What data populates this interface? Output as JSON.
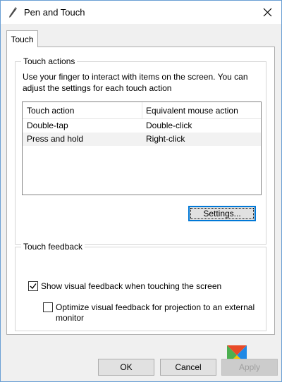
{
  "window": {
    "title": "Pen and Touch",
    "icon": "pen-icon",
    "close_icon": "close-icon"
  },
  "tabs": [
    {
      "label": "Touch",
      "selected": true
    }
  ],
  "touch_actions": {
    "group_title": "Touch actions",
    "description": "Use your finger to interact with items on the screen. You can adjust the settings for each touch action",
    "columns": [
      "Touch action",
      "Equivalent mouse action"
    ],
    "rows": [
      {
        "action": "Double-tap",
        "mouse": "Double-click"
      },
      {
        "action": "Press and hold",
        "mouse": "Right-click"
      }
    ],
    "settings_label": "Settings..."
  },
  "touch_feedback": {
    "group_title": "Touch feedback",
    "show_visual": {
      "label": "Show visual feedback when touching the screen",
      "checked": true
    },
    "optimize": {
      "label": "Optimize visual feedback for projection to an external monitor",
      "checked": false
    }
  },
  "buttons": {
    "ok": "OK",
    "cancel": "Cancel",
    "apply": "Apply"
  },
  "colors": {
    "focus_accent": "#0078d7",
    "window_border": "#6a9fd4"
  }
}
